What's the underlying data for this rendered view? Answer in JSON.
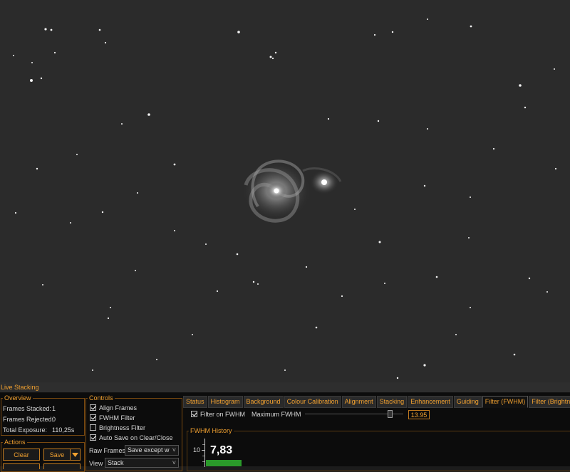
{
  "panel": {
    "title": "Live Stacking"
  },
  "overview": {
    "legend": "Overview",
    "frames_stacked_label": "Frames Stacked:",
    "frames_stacked": "1",
    "frames_rejected_label": "Frames Rejected:",
    "frames_rejected": "0",
    "total_exposure_label": "Total Exposure:",
    "total_exposure": "110,25s"
  },
  "actions": {
    "legend": "Actions",
    "clear": "Clear",
    "save": "Save"
  },
  "controls": {
    "legend": "Controls",
    "align_frames": {
      "label": "Align Frames",
      "checked": true
    },
    "fwhm_filter": {
      "label": "FWHM Filter",
      "checked": true
    },
    "brightness_filter": {
      "label": "Brightness Filter",
      "checked": false
    },
    "auto_save": {
      "label": "Auto Save on Clear/Close",
      "checked": true
    },
    "raw_frames_label": "Raw Frames",
    "raw_frames_value": "Save except w",
    "view_label": "View",
    "view_value": "Stack"
  },
  "tabs": [
    "Status",
    "Histogram",
    "Background",
    "Colour Calibration",
    "Alignment",
    "Stacking",
    "Enhancement",
    "Guiding",
    "Filter (FWHM)",
    "Filter (Brightness)"
  ],
  "active_tab": 8,
  "filter_fwhm": {
    "filter_on_label": "Filter on FWHM",
    "filter_on_checked": true,
    "max_label": "Maximum FWHM",
    "max_value": "13.95",
    "slider_fraction": 0.86,
    "history_legend": "FWHM History",
    "axis_tick": "10",
    "current_value": "7,83",
    "bar_color": "#2a9a2a"
  },
  "colors": {
    "accent": "#f0a030",
    "sky": "#2b2b2b"
  }
}
